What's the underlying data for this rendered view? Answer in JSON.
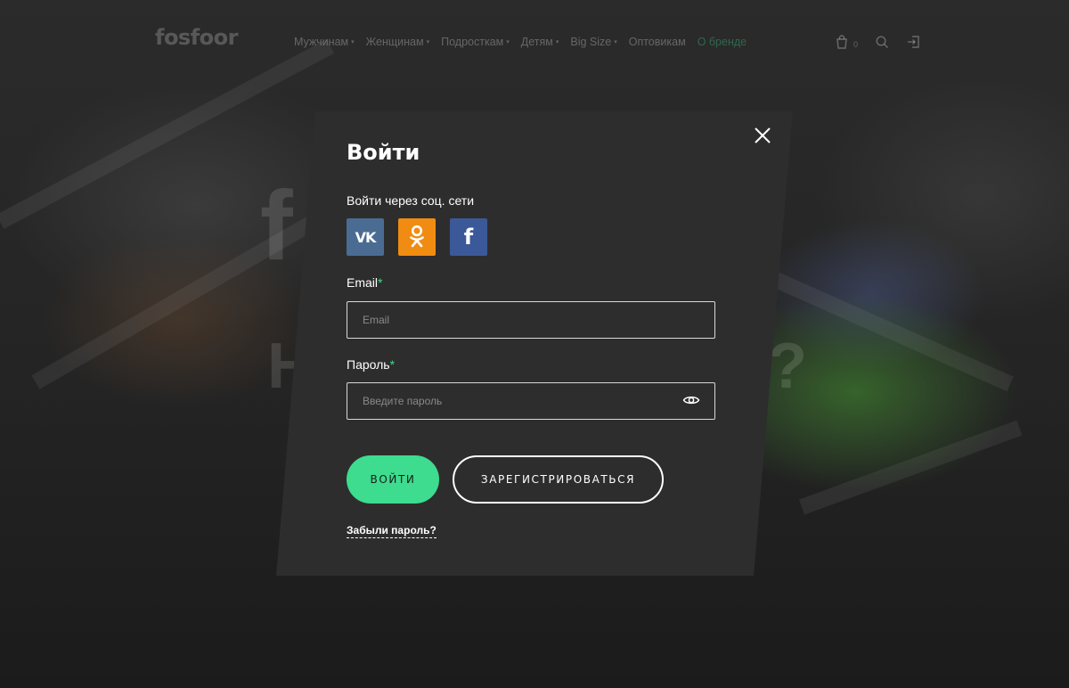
{
  "header": {
    "logo": "fosfoor",
    "nav": [
      {
        "label": "Мужчинам",
        "caret": "▾"
      },
      {
        "label": "Женщинам",
        "caret": "▾"
      },
      {
        "label": "Подросткам",
        "caret": "▾"
      },
      {
        "label": "Детям",
        "caret": "▾"
      },
      {
        "label": "Big Size",
        "caret": "▾"
      },
      {
        "label": "Оптовикам",
        "caret": ""
      },
      {
        "label": "О бренде",
        "caret": ""
      }
    ],
    "cart_count": "0"
  },
  "background": {
    "word_1": "f",
    "word_2": "H",
    "word_3": "?"
  },
  "login_modal": {
    "title": "Войти",
    "social_label": "Войти через соц. сети",
    "social": [
      {
        "name": "vk",
        "glyph": "VK",
        "color": "#4a6c93"
      },
      {
        "name": "ok",
        "glyph": "ok",
        "color": "#f08c12"
      },
      {
        "name": "facebook",
        "glyph": "f",
        "color": "#3b5998"
      }
    ],
    "email": {
      "label": "Email",
      "required_mark": "*",
      "placeholder": "Email",
      "value": ""
    },
    "password": {
      "label": "Пароль",
      "required_mark": "*",
      "placeholder": "Введите пароль",
      "value": ""
    },
    "login_button": "ВОЙТИ",
    "register_button": "ЗАРЕГИСТРИРОВАТЬСЯ",
    "forgot_link": "Забыли пароль?"
  },
  "colors": {
    "accent": "#3ddc8e",
    "modal_bg": "#2e2e2e"
  }
}
